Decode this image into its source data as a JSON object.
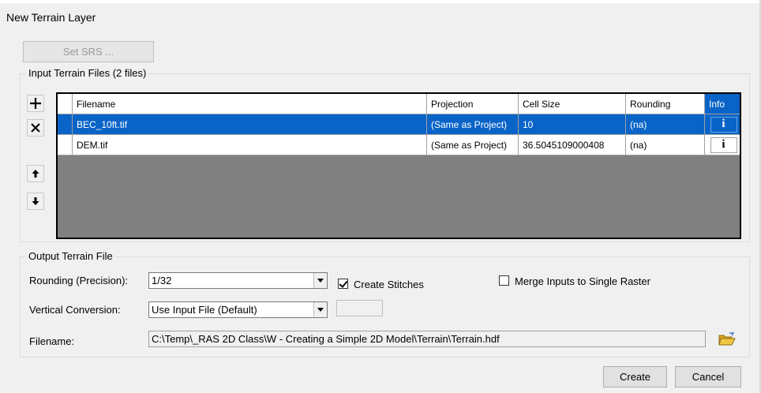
{
  "window": {
    "title": "New Terrain Layer"
  },
  "toolbar": {
    "set_srs_label": "Set SRS ..."
  },
  "input_group": {
    "legend": "Input Terrain Files (2 files)",
    "columns": [
      "Filename",
      "Projection",
      "Cell Size",
      "Rounding",
      "Info"
    ],
    "rows": [
      {
        "filename": "BEC_10ft.tif",
        "projection": "(Same as Project)",
        "cell_size": "10",
        "rounding": "(na)",
        "info": "i",
        "selected": true
      },
      {
        "filename": "DEM.tif",
        "projection": "(Same as Project)",
        "cell_size": "36.5045109000408",
        "rounding": "(na)",
        "info": "i",
        "selected": false
      }
    ],
    "buttons": {
      "add": "+",
      "remove": "✕",
      "up": "↑",
      "down": "↓"
    }
  },
  "output_group": {
    "legend": "Output Terrain File",
    "rounding_label": "Rounding (Precision):",
    "rounding_value": "1/32",
    "create_stitches_label": "Create Stitches",
    "create_stitches_checked": true,
    "merge_label": "Merge Inputs to Single Raster",
    "merge_checked": false,
    "vertical_label": "Vertical Conversion:",
    "vertical_value": "Use Input File (Default)",
    "filename_label": "Filename:",
    "filename_value": "C:\\Temp\\_RAS 2D Class\\W - Creating a Simple 2D Model\\Terrain\\Terrain.hdf"
  },
  "footer": {
    "create_label": "Create",
    "cancel_label": "Cancel"
  },
  "colors": {
    "selection": "#0a64c8",
    "window_bg": "#f0f0f0",
    "grid_bg": "#808080"
  }
}
